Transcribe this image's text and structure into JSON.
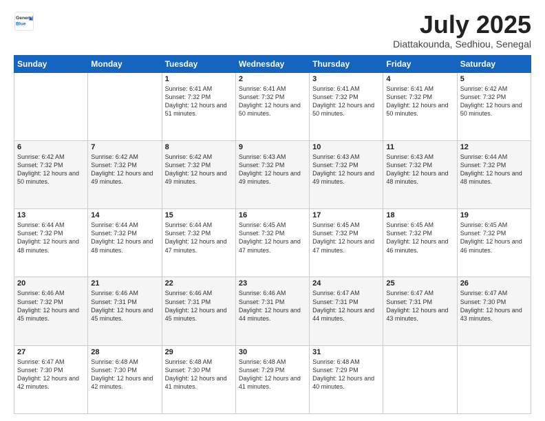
{
  "header": {
    "logo": {
      "general": "General",
      "blue": "Blue"
    },
    "month": "July 2025",
    "location": "Diattakounda, Sedhiou, Senegal"
  },
  "weekdays": [
    "Sunday",
    "Monday",
    "Tuesday",
    "Wednesday",
    "Thursday",
    "Friday",
    "Saturday"
  ],
  "weeks": [
    [
      {
        "day": "",
        "info": ""
      },
      {
        "day": "",
        "info": ""
      },
      {
        "day": "1",
        "info": "Sunrise: 6:41 AM\nSunset: 7:32 PM\nDaylight: 12 hours and 51 minutes."
      },
      {
        "day": "2",
        "info": "Sunrise: 6:41 AM\nSunset: 7:32 PM\nDaylight: 12 hours and 50 minutes."
      },
      {
        "day": "3",
        "info": "Sunrise: 6:41 AM\nSunset: 7:32 PM\nDaylight: 12 hours and 50 minutes."
      },
      {
        "day": "4",
        "info": "Sunrise: 6:41 AM\nSunset: 7:32 PM\nDaylight: 12 hours and 50 minutes."
      },
      {
        "day": "5",
        "info": "Sunrise: 6:42 AM\nSunset: 7:32 PM\nDaylight: 12 hours and 50 minutes."
      }
    ],
    [
      {
        "day": "6",
        "info": "Sunrise: 6:42 AM\nSunset: 7:32 PM\nDaylight: 12 hours and 50 minutes."
      },
      {
        "day": "7",
        "info": "Sunrise: 6:42 AM\nSunset: 7:32 PM\nDaylight: 12 hours and 49 minutes."
      },
      {
        "day": "8",
        "info": "Sunrise: 6:42 AM\nSunset: 7:32 PM\nDaylight: 12 hours and 49 minutes."
      },
      {
        "day": "9",
        "info": "Sunrise: 6:43 AM\nSunset: 7:32 PM\nDaylight: 12 hours and 49 minutes."
      },
      {
        "day": "10",
        "info": "Sunrise: 6:43 AM\nSunset: 7:32 PM\nDaylight: 12 hours and 49 minutes."
      },
      {
        "day": "11",
        "info": "Sunrise: 6:43 AM\nSunset: 7:32 PM\nDaylight: 12 hours and 48 minutes."
      },
      {
        "day": "12",
        "info": "Sunrise: 6:44 AM\nSunset: 7:32 PM\nDaylight: 12 hours and 48 minutes."
      }
    ],
    [
      {
        "day": "13",
        "info": "Sunrise: 6:44 AM\nSunset: 7:32 PM\nDaylight: 12 hours and 48 minutes."
      },
      {
        "day": "14",
        "info": "Sunrise: 6:44 AM\nSunset: 7:32 PM\nDaylight: 12 hours and 48 minutes."
      },
      {
        "day": "15",
        "info": "Sunrise: 6:44 AM\nSunset: 7:32 PM\nDaylight: 12 hours and 47 minutes."
      },
      {
        "day": "16",
        "info": "Sunrise: 6:45 AM\nSunset: 7:32 PM\nDaylight: 12 hours and 47 minutes."
      },
      {
        "day": "17",
        "info": "Sunrise: 6:45 AM\nSunset: 7:32 PM\nDaylight: 12 hours and 47 minutes."
      },
      {
        "day": "18",
        "info": "Sunrise: 6:45 AM\nSunset: 7:32 PM\nDaylight: 12 hours and 46 minutes."
      },
      {
        "day": "19",
        "info": "Sunrise: 6:45 AM\nSunset: 7:32 PM\nDaylight: 12 hours and 46 minutes."
      }
    ],
    [
      {
        "day": "20",
        "info": "Sunrise: 6:46 AM\nSunset: 7:32 PM\nDaylight: 12 hours and 45 minutes."
      },
      {
        "day": "21",
        "info": "Sunrise: 6:46 AM\nSunset: 7:31 PM\nDaylight: 12 hours and 45 minutes."
      },
      {
        "day": "22",
        "info": "Sunrise: 6:46 AM\nSunset: 7:31 PM\nDaylight: 12 hours and 45 minutes."
      },
      {
        "day": "23",
        "info": "Sunrise: 6:46 AM\nSunset: 7:31 PM\nDaylight: 12 hours and 44 minutes."
      },
      {
        "day": "24",
        "info": "Sunrise: 6:47 AM\nSunset: 7:31 PM\nDaylight: 12 hours and 44 minutes."
      },
      {
        "day": "25",
        "info": "Sunrise: 6:47 AM\nSunset: 7:31 PM\nDaylight: 12 hours and 43 minutes."
      },
      {
        "day": "26",
        "info": "Sunrise: 6:47 AM\nSunset: 7:30 PM\nDaylight: 12 hours and 43 minutes."
      }
    ],
    [
      {
        "day": "27",
        "info": "Sunrise: 6:47 AM\nSunset: 7:30 PM\nDaylight: 12 hours and 42 minutes."
      },
      {
        "day": "28",
        "info": "Sunrise: 6:48 AM\nSunset: 7:30 PM\nDaylight: 12 hours and 42 minutes."
      },
      {
        "day": "29",
        "info": "Sunrise: 6:48 AM\nSunset: 7:30 PM\nDaylight: 12 hours and 41 minutes."
      },
      {
        "day": "30",
        "info": "Sunrise: 6:48 AM\nSunset: 7:29 PM\nDaylight: 12 hours and 41 minutes."
      },
      {
        "day": "31",
        "info": "Sunrise: 6:48 AM\nSunset: 7:29 PM\nDaylight: 12 hours and 40 minutes."
      },
      {
        "day": "",
        "info": ""
      },
      {
        "day": "",
        "info": ""
      }
    ]
  ]
}
